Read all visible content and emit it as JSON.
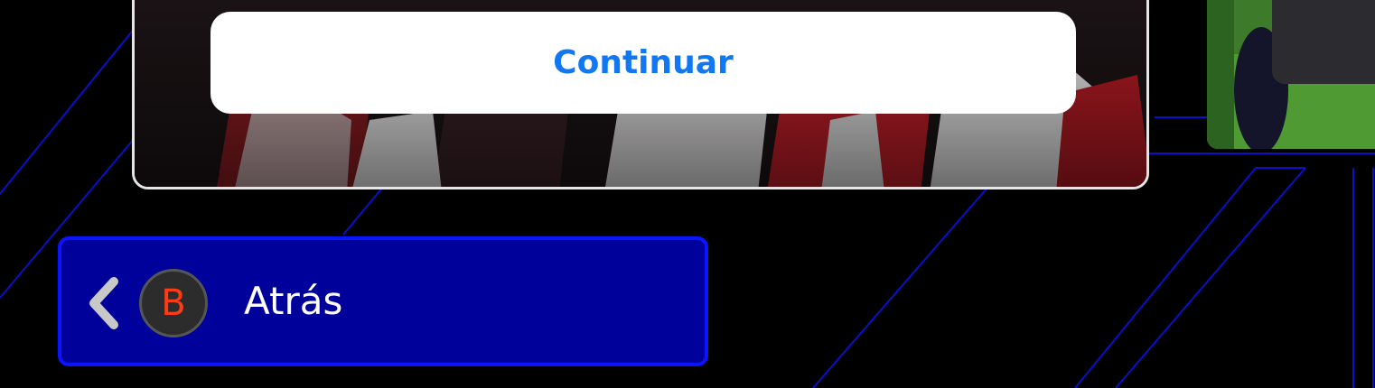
{
  "dialog": {
    "continue_label": "Continuar"
  },
  "back": {
    "button_letter": "B",
    "label": "Atrás"
  },
  "colors": {
    "accent_blue": "#1177f2",
    "back_bg": "#00009a",
    "back_border": "#0a14ff",
    "badge_letter": "#ff3b14",
    "line_blue": "#0a10c8"
  },
  "icons": {
    "back": "chevron-left-icon"
  }
}
